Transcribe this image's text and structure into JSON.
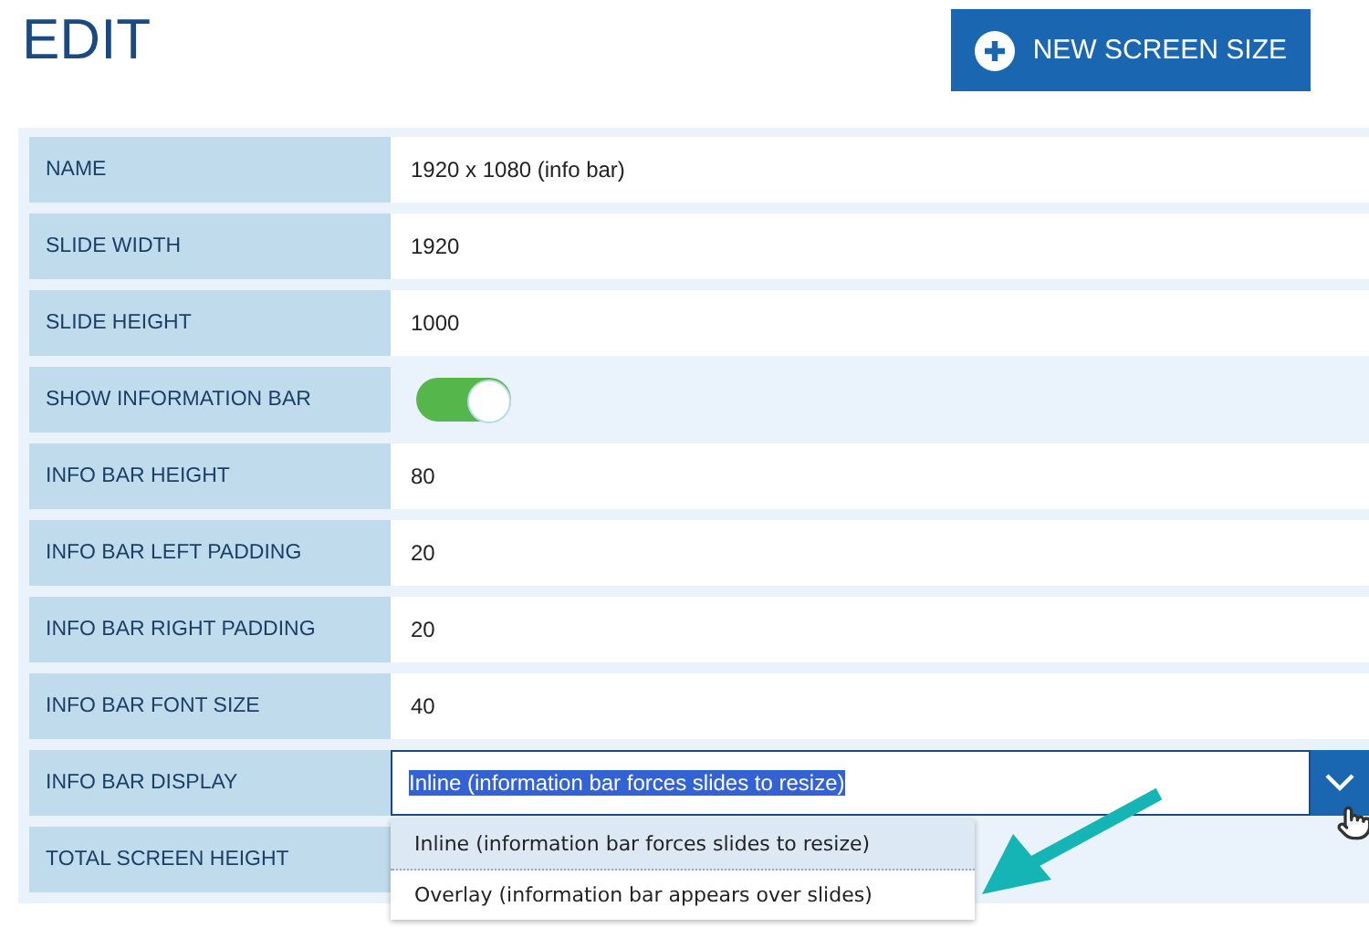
{
  "title": "EDIT",
  "new_button": {
    "label": "NEW SCREEN SIZE"
  },
  "rows": [
    {
      "label": "NAME",
      "kind": "text",
      "value": "1920 x 1080 (info bar)"
    },
    {
      "label": "SLIDE WIDTH",
      "kind": "text",
      "value": "1920"
    },
    {
      "label": "SLIDE HEIGHT",
      "kind": "text",
      "value": "1000"
    },
    {
      "label": "SHOW INFORMATION BAR",
      "kind": "toggle",
      "on": true
    },
    {
      "label": "INFO BAR HEIGHT",
      "kind": "text",
      "value": "80"
    },
    {
      "label": "INFO BAR LEFT PADDING",
      "kind": "text",
      "value": "20"
    },
    {
      "label": "INFO BAR RIGHT PADDING",
      "kind": "text",
      "value": "20"
    },
    {
      "label": "INFO BAR FONT SIZE",
      "kind": "text",
      "value": "40"
    },
    {
      "label": "INFO BAR DISPLAY",
      "kind": "select",
      "value": "Inline (information bar forces slides to resize)",
      "expanded": true,
      "options": [
        {
          "label": "Inline (information bar forces slides to resize)",
          "selected": true
        },
        {
          "label": "Overlay (information bar appears over slides)",
          "selected": false
        }
      ]
    },
    {
      "label": "TOTAL SCREEN HEIGHT",
      "kind": "empty"
    }
  ]
}
